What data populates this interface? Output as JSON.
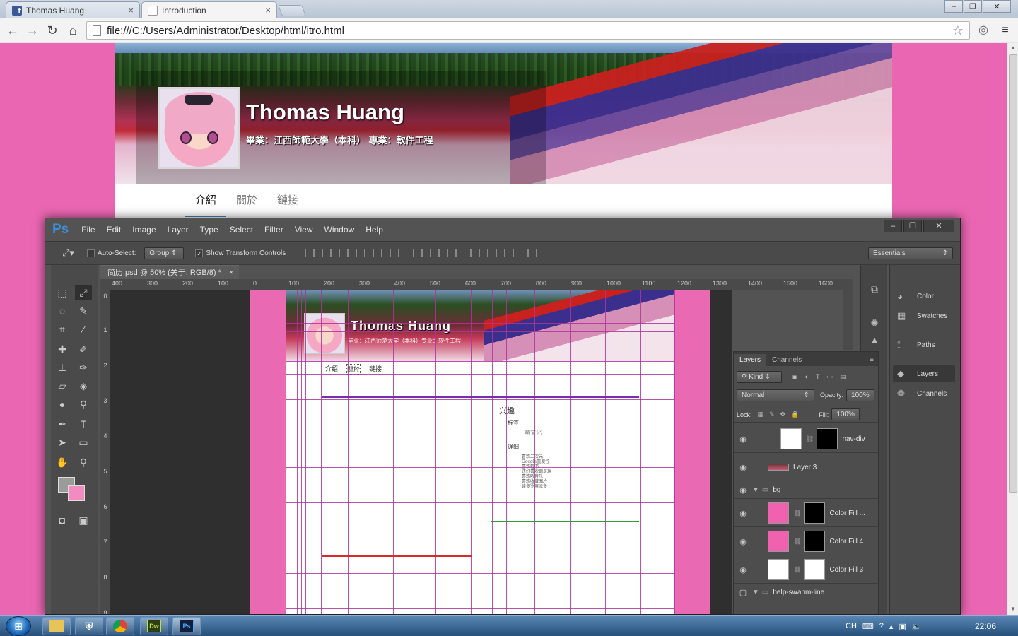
{
  "browser": {
    "tabs": [
      {
        "title": "Thomas Huang",
        "icon": "facebook-icon",
        "active": false
      },
      {
        "title": "Introduction",
        "icon": "page-icon",
        "active": true
      }
    ],
    "url": "file:///C:/Users/Administrator/Desktop/html/itro.html",
    "tab_close": "×",
    "window_buttons": [
      "‒",
      "❐",
      "✕"
    ]
  },
  "site": {
    "name": "Thomas Huang",
    "subtitle": "畢業：江西師範大學（本科） 專業：軟件工程",
    "nav": [
      {
        "label": "介紹",
        "active": true
      },
      {
        "label": "關於",
        "active": false
      },
      {
        "label": "鏈接",
        "active": false
      }
    ],
    "colors": {
      "background": "#ea66b2",
      "nav_underline": "#4b7fb3"
    }
  },
  "photoshop": {
    "logo": "Ps",
    "menu": [
      "File",
      "Edit",
      "Image",
      "Layer",
      "Type",
      "Select",
      "Filter",
      "View",
      "Window",
      "Help"
    ],
    "options": {
      "auto_select_label": "Auto-Select:",
      "auto_select_value": "Group",
      "show_transform_label": "Show Transform Controls",
      "workspace": "Essentials"
    },
    "document_tab": "简历.psd @ 50% (关于, RGB/8) *",
    "ruler_h": [
      "400",
      "300",
      "200",
      "100",
      "0",
      "100",
      "200",
      "300",
      "400",
      "500",
      "600",
      "700",
      "800",
      "900",
      "1000",
      "1100",
      "1200",
      "1300",
      "1400",
      "1500",
      "1600"
    ],
    "ruler_v": [
      "0",
      "1",
      "2",
      "3",
      "4",
      "5",
      "6",
      "7",
      "8",
      "9"
    ],
    "canvas": {
      "name": "Thomas  Huang",
      "subtitle": "毕业：江西师范大学（本科）专业：软件工程",
      "nav": [
        "介绍",
        "關於",
        "链接"
      ],
      "section_title": "兴趣",
      "tag_label": "标签",
      "tag_value": "萌文化",
      "detail_label": "详细",
      "details": [
        "喜欢二次元",
        "Google重度控",
        "喜欢看书",
        "还好喜欢踢足球",
        "喜欢听音乐",
        "喜欢收藏图片",
        "读多罗嘛派多"
      ]
    },
    "dock": [
      {
        "label": "Color",
        "icon": "palette-icon"
      },
      {
        "label": "Swatches",
        "icon": "grid-icon"
      },
      {
        "label": "Paths",
        "icon": "pen-path-icon"
      },
      {
        "label": "Layers",
        "icon": "layers-icon"
      },
      {
        "label": "Channels",
        "icon": "channels-icon"
      }
    ],
    "layers_panel": {
      "tabs": [
        "Layers",
        "Channels"
      ],
      "filter": "Kind",
      "blend_mode": "Normal",
      "opacity_label": "Opacity:",
      "opacity": "100%",
      "lock_label": "Lock:",
      "fill_label": "Fill:",
      "fill": "100%",
      "layers": [
        {
          "name": "nav-div",
          "type": "masked",
          "thumb": "#ffffff",
          "mask": "#000000"
        },
        {
          "name": "Layer 3",
          "type": "image",
          "thumb": "#a34a6a"
        },
        {
          "name": "bg",
          "type": "group"
        },
        {
          "name": "Color Fill ...",
          "type": "fill",
          "thumb": "#f061b0",
          "mask": "#000000"
        },
        {
          "name": "Color Fill 4",
          "type": "fill",
          "thumb": "#f061b0",
          "mask": "#000000"
        },
        {
          "name": "Color Fill 3",
          "type": "fill",
          "thumb": "#ffffff",
          "mask": "#ffffff"
        },
        {
          "name": "help-swanm-line",
          "type": "group"
        }
      ]
    }
  },
  "taskbar": {
    "apps": [
      {
        "name": "explorer",
        "icon": "folder-icon"
      },
      {
        "name": "shield",
        "icon": "shield-icon"
      },
      {
        "name": "chrome",
        "icon": "chrome-icon"
      },
      {
        "name": "dreamweaver",
        "label": "Dw"
      },
      {
        "name": "photoshop",
        "label": "Ps"
      }
    ],
    "language": "CH",
    "time": "22:06"
  }
}
